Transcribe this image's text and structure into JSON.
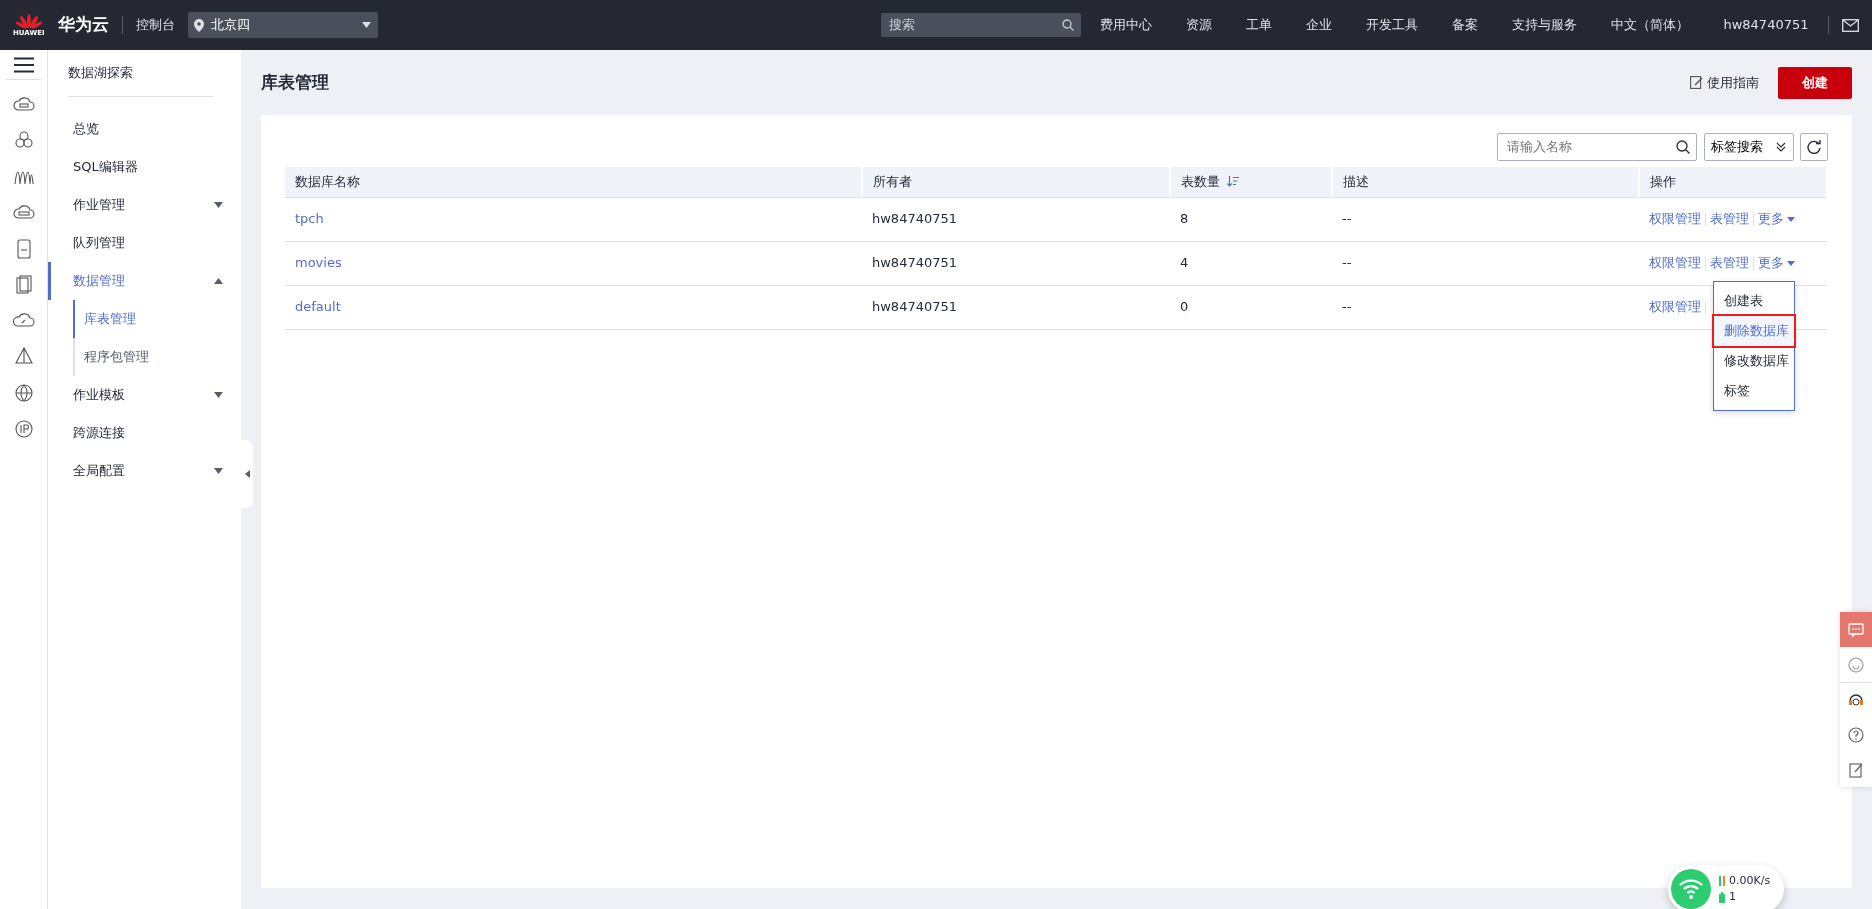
{
  "header": {
    "logo_text": "HUAWEI",
    "brand": "华为云",
    "console": "控制台",
    "region": "北京四",
    "search": {
      "placeholder": "搜索"
    },
    "nav": [
      "费用中心",
      "资源",
      "工单",
      "企业",
      "开发工具",
      "备案",
      "支持与服务",
      "中文（简体）"
    ],
    "user": "hw84740751"
  },
  "sidebar": {
    "title": "数据湖探索",
    "items": [
      {
        "label": "总览",
        "selected": false
      },
      {
        "label": "SQL编辑器",
        "selected": false
      },
      {
        "label": "作业管理",
        "selected": false,
        "expanded": false
      },
      {
        "label": "队列管理",
        "selected": false
      },
      {
        "label": "数据管理",
        "selected": true,
        "expanded": true,
        "children": [
          {
            "label": "库表管理",
            "selected": true
          },
          {
            "label": "程序包管理",
            "selected": false
          }
        ]
      },
      {
        "label": "作业模板",
        "selected": false,
        "expanded": false
      },
      {
        "label": "跨源连接",
        "selected": false
      },
      {
        "label": "全局配置",
        "selected": false,
        "expanded": false
      }
    ]
  },
  "page": {
    "title": "库表管理",
    "guide_link": "使用指南",
    "create_button": "创建"
  },
  "toolbar": {
    "search": {
      "placeholder": "请输入名称"
    },
    "tag_search": "标签搜索"
  },
  "table": {
    "columns": [
      {
        "label": "数据库名称",
        "sortable": false
      },
      {
        "label": "所有者",
        "sortable": false
      },
      {
        "label": "表数量",
        "sortable": true
      },
      {
        "label": "描述",
        "sortable": false
      },
      {
        "label": "操作",
        "sortable": false
      }
    ],
    "rows": [
      {
        "name": "tpch",
        "owner": "hw84740751",
        "count": "8",
        "description": "--",
        "actions": [
          "权限管理",
          "表管理",
          "更多"
        ]
      },
      {
        "name": "movies",
        "owner": "hw84740751",
        "count": "4",
        "description": "--",
        "actions": [
          "权限管理",
          "表管理",
          "更多"
        ]
      },
      {
        "name": "default",
        "owner": "hw84740751",
        "count": "0",
        "description": "--",
        "actions": [
          "权限管理"
        ]
      }
    ]
  },
  "more_menu": {
    "items": [
      {
        "label": "创建表",
        "highlighted": false
      },
      {
        "label": "删除数据库",
        "highlighted": true
      },
      {
        "label": "修改数据库",
        "highlighted": false
      },
      {
        "label": "标签",
        "highlighted": false
      }
    ]
  },
  "net_widget": {
    "speed": "0.00K/s",
    "connections": "1"
  }
}
